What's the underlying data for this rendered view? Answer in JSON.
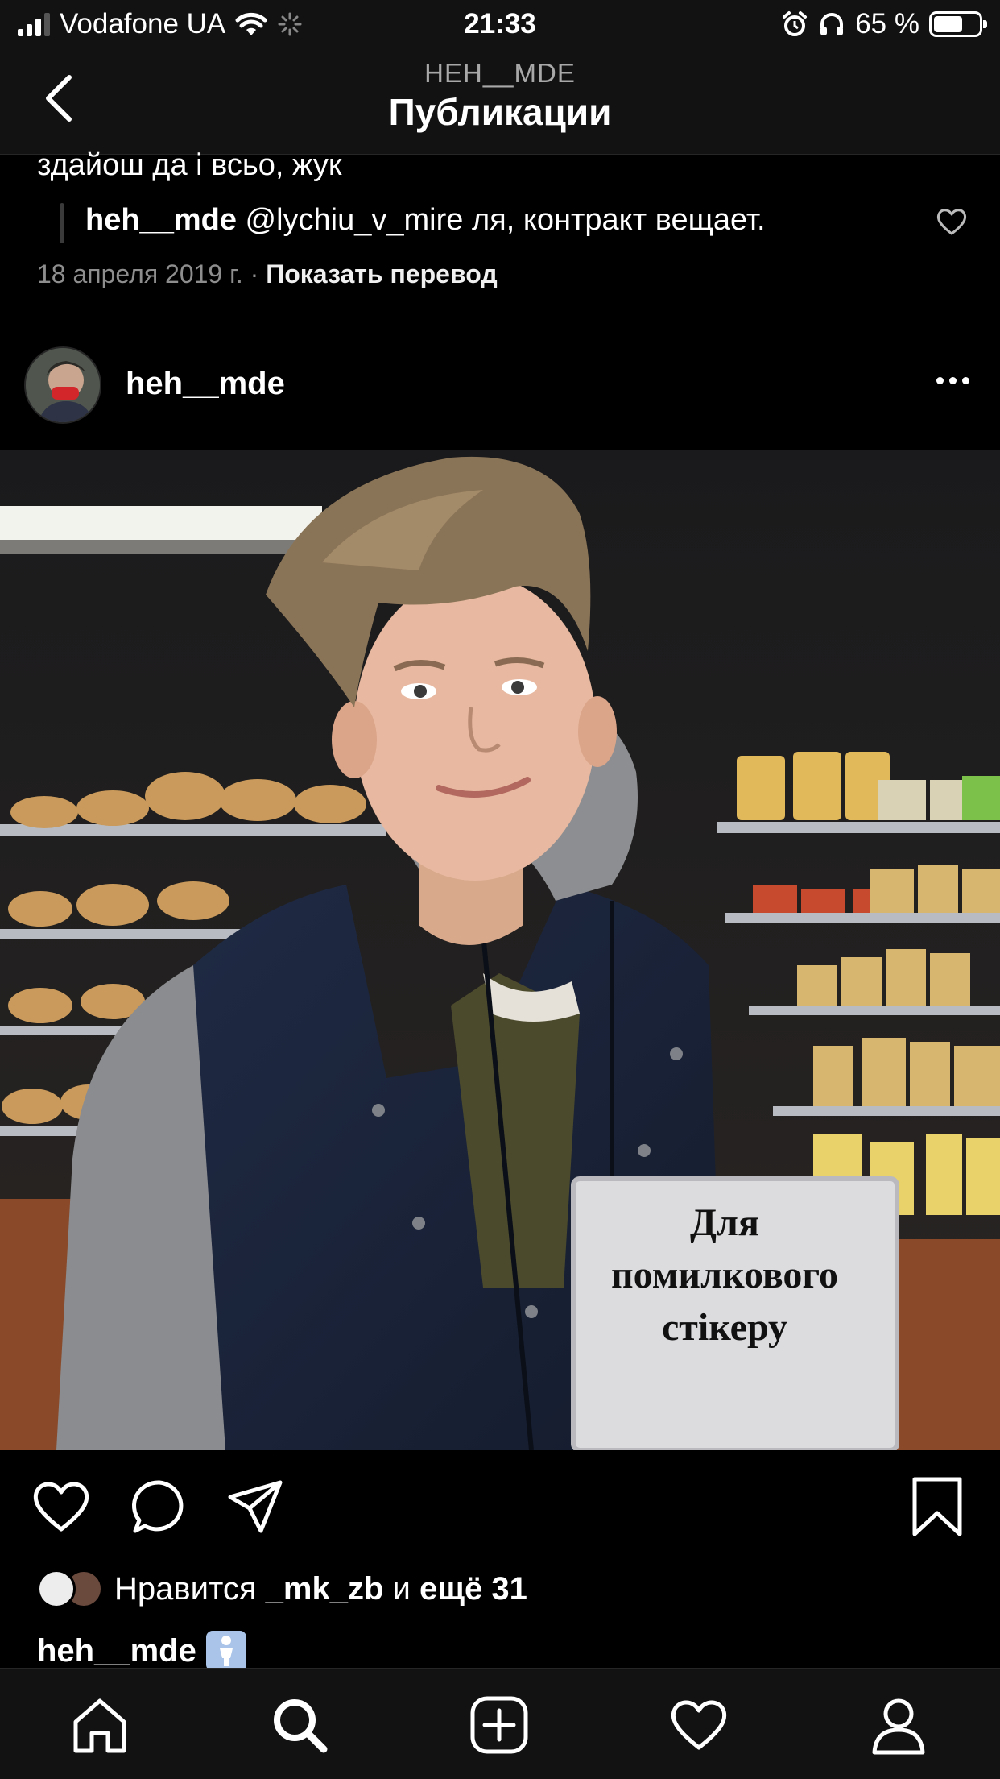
{
  "status_bar": {
    "carrier": "Vodafone UA",
    "time": "21:33",
    "battery": "65 %",
    "battery_level": 0.65
  },
  "header": {
    "subtitle": "HEH__MDE",
    "title": "Публикации"
  },
  "comments": {
    "cut_text": "здайош да і всьо, жук",
    "reply_user": "heh__mde",
    "reply_text": "@lychiu_v_mire ля, контракт вещает."
  },
  "post_meta": {
    "date": "18 апреля 2019 г.",
    "separator": "·",
    "translate_label": "Показать перевод"
  },
  "post": {
    "username": "heh__mde",
    "sign_lines": [
      "Для",
      "помилкового",
      "стікеру"
    ]
  },
  "likes": {
    "prefix": "Нравится",
    "user": "_mk_zb",
    "conj": "и",
    "more": "ещё 31"
  },
  "caption": {
    "username": "heh__mde"
  },
  "tabs": [
    "home-icon",
    "search-icon",
    "add-post-icon",
    "activity-icon",
    "profile-icon"
  ]
}
